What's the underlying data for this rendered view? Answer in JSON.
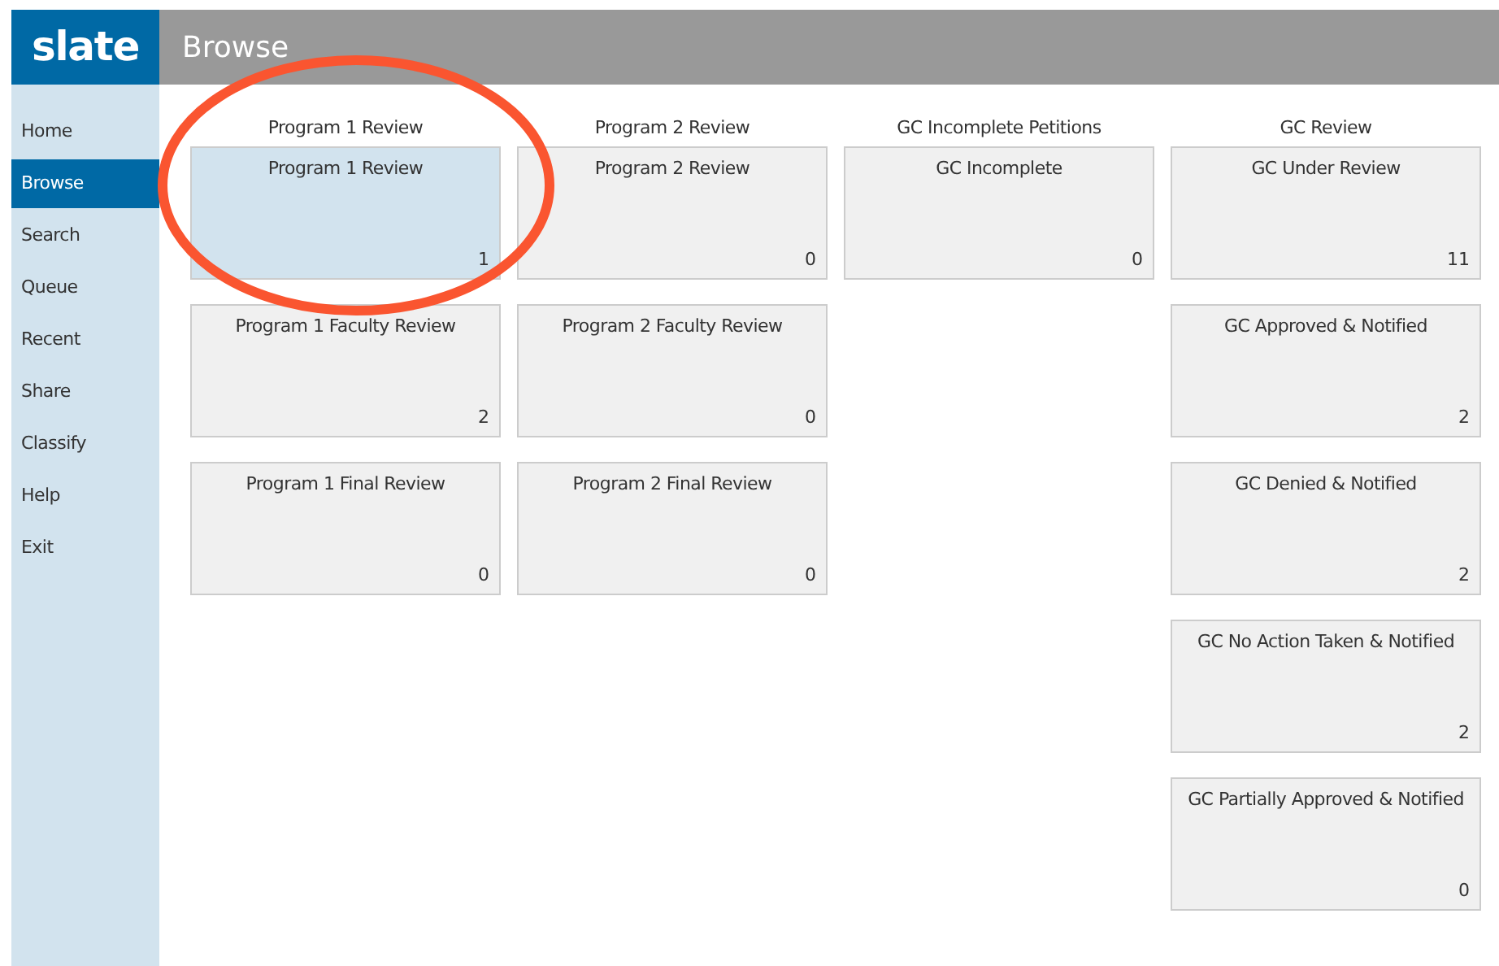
{
  "logo": "slate",
  "header": {
    "title": "Browse"
  },
  "sidebar": {
    "items": [
      {
        "label": "Home",
        "selected": false
      },
      {
        "label": "Browse",
        "selected": true
      },
      {
        "label": "Search",
        "selected": false
      },
      {
        "label": "Queue",
        "selected": false
      },
      {
        "label": "Recent",
        "selected": false
      },
      {
        "label": "Share",
        "selected": false
      },
      {
        "label": "Classify",
        "selected": false
      },
      {
        "label": "Help",
        "selected": false
      },
      {
        "label": "Exit",
        "selected": false
      }
    ]
  },
  "columns": [
    {
      "heading": "Program 1 Review",
      "tiles": [
        {
          "title": "Program 1 Review",
          "count": "1",
          "selected": true
        },
        {
          "title": "Program 1 Faculty Review",
          "count": "2",
          "selected": false
        },
        {
          "title": "Program 1 Final Review",
          "count": "0",
          "selected": false
        }
      ]
    },
    {
      "heading": "Program 2 Review",
      "tiles": [
        {
          "title": "Program 2 Review",
          "count": "0",
          "selected": false
        },
        {
          "title": "Program 2 Faculty Review",
          "count": "0",
          "selected": false
        },
        {
          "title": "Program 2 Final Review",
          "count": "0",
          "selected": false
        }
      ]
    },
    {
      "heading": "GC Incomplete Petitions",
      "tiles": [
        {
          "title": "GC Incomplete",
          "count": "0",
          "selected": false
        }
      ]
    },
    {
      "heading": "GC Review",
      "tiles": [
        {
          "title": "GC Under Review",
          "count": "11",
          "selected": false
        },
        {
          "title": "GC Approved & Notified",
          "count": "2",
          "selected": false
        },
        {
          "title": "GC Denied & Notified",
          "count": "2",
          "selected": false
        },
        {
          "title": "GC No Action Taken & Notified",
          "count": "2",
          "selected": false
        },
        {
          "title": "GC Partially Approved & Notified",
          "count": "0",
          "selected": false
        }
      ]
    }
  ]
}
